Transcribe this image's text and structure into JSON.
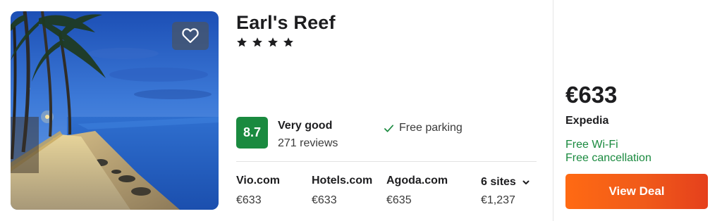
{
  "hotel": {
    "name": "Earl's Reef",
    "star_count": 4,
    "photo_alt": "Beach with palm trees at dusk",
    "favorite_icon": "heart-icon"
  },
  "rating": {
    "score": "8.7",
    "label": "Very good",
    "reviews": "271 reviews"
  },
  "amenities": [
    {
      "icon": "check-icon",
      "label": "Free parking"
    }
  ],
  "sites": [
    {
      "name": "Vio.com",
      "price": "€633"
    },
    {
      "name": "Hotels.com",
      "price": "€633"
    },
    {
      "name": "Agoda.com",
      "price": "€635"
    }
  ],
  "more_sites": {
    "label": "6 sites",
    "price": "€1,237",
    "icon": "chevron-down-icon"
  },
  "deal": {
    "price": "€633",
    "provider": "Expedia",
    "perks": [
      "Free Wi-Fi",
      "Free cancellation"
    ],
    "button_label": "View Deal"
  },
  "colors": {
    "rating_badge": "#1a8a3f",
    "perk_text": "#1a8a3f",
    "deal_button": "#f05a1a"
  }
}
